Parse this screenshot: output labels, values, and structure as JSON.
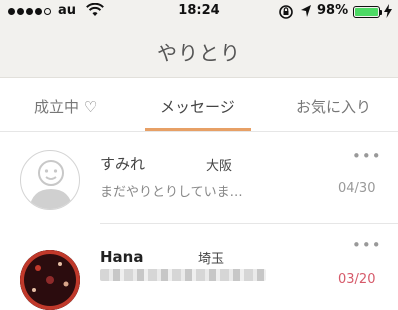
{
  "status_bar": {
    "carrier": "au",
    "time": "18:24",
    "battery": "98%",
    "signal_bars_filled": 4,
    "signal_bars_total": 5,
    "battery_level": 0.98,
    "battery_color": "#4cd964",
    "icons": [
      "wifi-icon",
      "orientation-lock-icon",
      "location-arrow-icon",
      "battery-icon",
      "charging-bolt-icon"
    ]
  },
  "header": {
    "title": "やりとり",
    "background": "#f2f1ee"
  },
  "tabs": [
    {
      "label": "成立中 ♡",
      "active": false
    },
    {
      "label": "メッセージ",
      "active": true
    },
    {
      "label": "お気に入り",
      "active": false
    }
  ],
  "accent_color": "#e7a066",
  "conversations": [
    {
      "name": "すみれ",
      "prefecture": "大阪",
      "last_message": "まだやりとりしていま…",
      "date": "04/30",
      "more_label": "•••",
      "avatar": "default-avatar-icon",
      "date_color": "#999999"
    },
    {
      "name": "Hana",
      "prefecture": "埼玉",
      "last_message": "",
      "date": "03/20",
      "more_label": "•••",
      "avatar": "photo-avatar",
      "date_color": "#d65a6a"
    }
  ]
}
